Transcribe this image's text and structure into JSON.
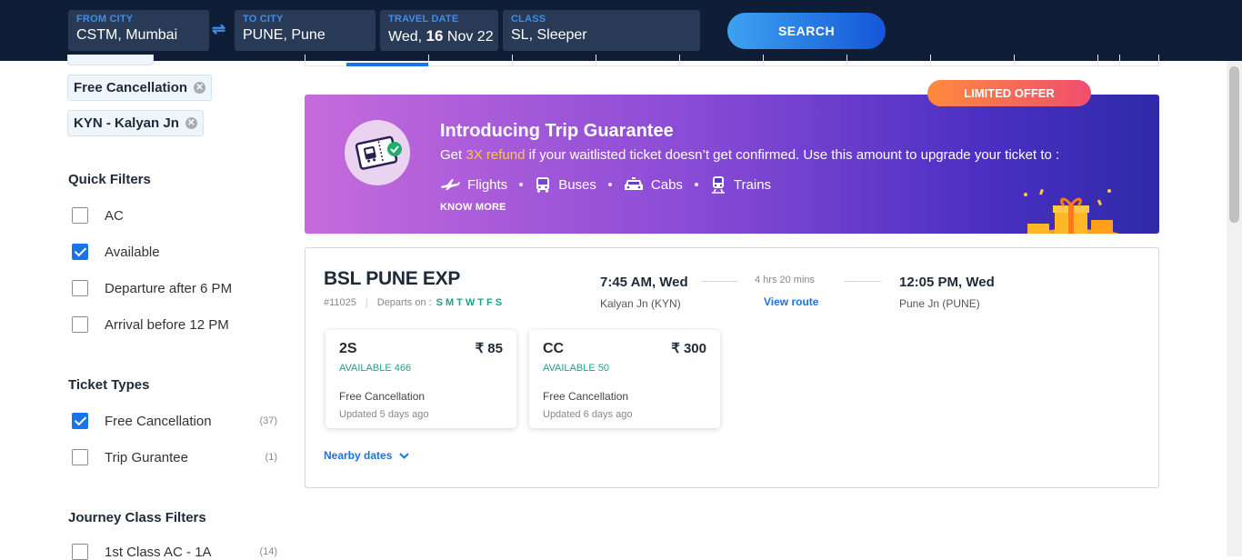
{
  "search": {
    "from_label": "FROM CITY",
    "from_value": "CSTM, Mumbai",
    "to_label": "TO CITY",
    "to_value": "PUNE, Pune",
    "date_label": "TRAVEL DATE",
    "date_day": "Wed,",
    "date_num": "16",
    "date_rest": "Nov 22",
    "class_label": "CLASS",
    "class_value": "SL, Sleeper",
    "swap_icon": "⇌",
    "search_button": "SEARCH"
  },
  "sidebar": {
    "applied_chips": [
      {
        "label": "Free Cancellation"
      },
      {
        "label": "KYN - Kalyan Jn"
      }
    ],
    "quick_filters": {
      "title": "Quick Filters",
      "items": [
        {
          "label": "AC",
          "checked": false
        },
        {
          "label": "Available",
          "checked": true
        },
        {
          "label": "Departure after 6 PM",
          "checked": false
        },
        {
          "label": "Arrival before 12 PM",
          "checked": false
        }
      ]
    },
    "ticket_types": {
      "title": "Ticket Types",
      "items": [
        {
          "label": "Free Cancellation",
          "count": "(37)",
          "checked": true
        },
        {
          "label": "Trip Gurantee",
          "count": "(1)",
          "checked": false
        }
      ]
    },
    "journey_class": {
      "title": "Journey Class Filters",
      "items": [
        {
          "label": "1st Class AC - 1A",
          "count": "(14)",
          "checked": false
        }
      ]
    }
  },
  "banner": {
    "badge": "LIMITED OFFER",
    "title": "Introducing Trip Guarantee",
    "sub_pre": "Get ",
    "sub_highlight": "3X refund",
    "sub_post": " if your waitlisted ticket doesn’t get confirmed. Use this amount to upgrade your ticket to :",
    "modes": [
      "Flights",
      "Buses",
      "Cabs",
      "Trains"
    ],
    "know_more": "KNOW MORE",
    "highlight_color": "#ffc44d"
  },
  "train": {
    "name": "BSL PUNE EXP",
    "number": "#11025",
    "departs_label": "Departs on :",
    "days": "SMTWTFS",
    "dep_time": "7:45 AM, Wed",
    "dep_station": "Kalyan Jn (KYN)",
    "duration": "4 hrs 20 mins",
    "view_route": "View route",
    "arr_time": "12:05 PM, Wed",
    "arr_station": "Pune Jn (PUNE)",
    "classes": [
      {
        "name": "2S",
        "price": "₹ 85",
        "availability": "AVAILABLE 466",
        "cancellation": "Free Cancellation",
        "updated": "Updated 5 days ago"
      },
      {
        "name": "CC",
        "price": "₹ 300",
        "availability": "AVAILABLE 50",
        "cancellation": "Free Cancellation",
        "updated": "Updated 6 days ago"
      }
    ],
    "nearby_dates": "Nearby dates"
  },
  "colors": {
    "accent": "#1a73e8",
    "available_green": "#1aa38a",
    "header_bg": "#0f1e36"
  }
}
